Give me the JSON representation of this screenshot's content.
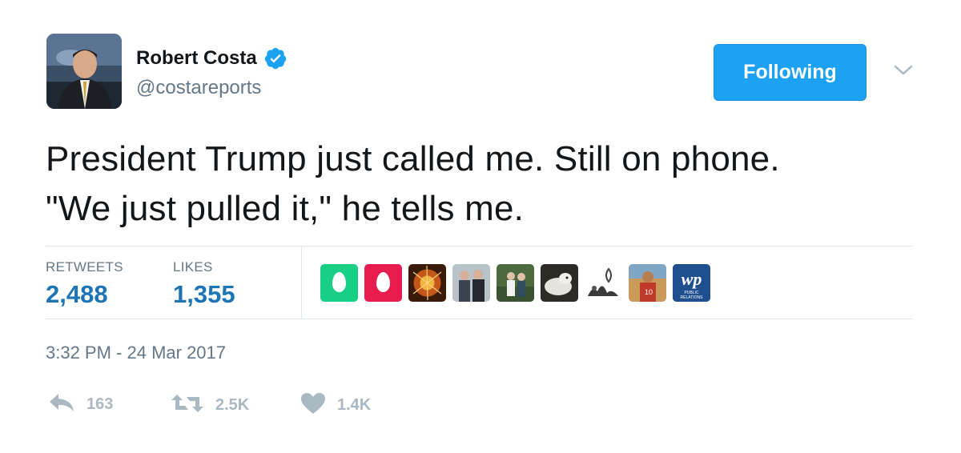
{
  "author": {
    "name": "Robert Costa",
    "handle": "@costareports",
    "avatar_icon": "profile-photo",
    "verified_icon": "verified-badge-icon"
  },
  "follow_button": {
    "label": "Following"
  },
  "tweet": {
    "lines": [
      "President Trump just called me. Still on phone.",
      "\"We just pulled it,\" he tells me."
    ]
  },
  "stats": {
    "retweets_label": "RETWEETS",
    "retweets_value": "2,488",
    "likes_label": "LIKES",
    "likes_value": "1,355"
  },
  "likers": [
    {
      "kind": "egg",
      "color": "#19cf86"
    },
    {
      "kind": "egg",
      "color": "#e81c4f"
    },
    {
      "kind": "photo",
      "color": "#8a3a12"
    },
    {
      "kind": "photo",
      "color": "#7d8a93"
    },
    {
      "kind": "photo",
      "color": "#4d6a3e"
    },
    {
      "kind": "photo",
      "color": "#5c5a55"
    },
    {
      "kind": "photo",
      "color": "#c9c9c9"
    },
    {
      "kind": "photo",
      "color": "#a66b2c"
    },
    {
      "kind": "logo",
      "color": "#1f4f8f",
      "text": "wp",
      "sub": "PUBLIC RELATIONS"
    }
  ],
  "timestamp": "3:32 PM - 24 Mar 2017",
  "actions": {
    "reply_count": "163",
    "retweet_count": "2.5K",
    "like_count": "1.4K"
  },
  "colors": {
    "accent": "#1da1f2",
    "link": "#1d75b5",
    "muted": "#657786",
    "icon_muted": "#aab8c2"
  }
}
